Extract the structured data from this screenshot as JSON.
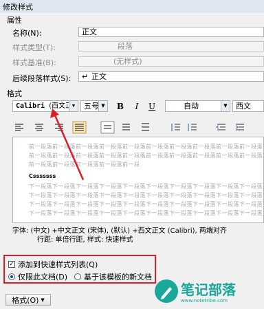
{
  "title": "修改样式",
  "properties": {
    "heading": "属性",
    "name_label": "名称(N):",
    "name_value": "正文",
    "type_label": "样式类型(T):",
    "type_value": "段落",
    "base_label": "样式基准(B):",
    "base_value": "(无样式)",
    "next_label": "后续段落样式(S):",
    "next_value": "正文"
  },
  "format": {
    "heading": "格式",
    "font": "Calibri",
    "font_script": "(西文正",
    "size": "五号",
    "bold": "B",
    "italic": "I",
    "underline": "U",
    "color": "自动",
    "script": "西文"
  },
  "preview": {
    "prev_para": "前一段落前一段落前一段落前一段落前一段落前一段落前一段落前一段落前一段落前一段落前一段落前一段落前一段落前一段落",
    "sample": "Csssssss",
    "next_para": "下一段落下一段落下一段落下一段落下一段落下一段落下一段落下一段落下一段落下一段落下一段落下一段落下一段落下一段落"
  },
  "description": {
    "line1": "字体: (中文) +中文正文 (宋体), (默认) +西文正文 (Calibri), 两端对齐",
    "line2": "行距: 单倍行距, 样式: 快速样式"
  },
  "options": {
    "add_quick": "添加到快速样式列表(Q)",
    "only_doc": "仅限此文档(D)",
    "new_docs": "基于该模板的新文档"
  },
  "footer": {
    "format_button": "格式(O)"
  },
  "watermark": {
    "brand": "笔记部落",
    "url": "www.notetribe.com"
  },
  "colors": {
    "highlight": "#d9202a",
    "watermark": "#1aa89a"
  }
}
